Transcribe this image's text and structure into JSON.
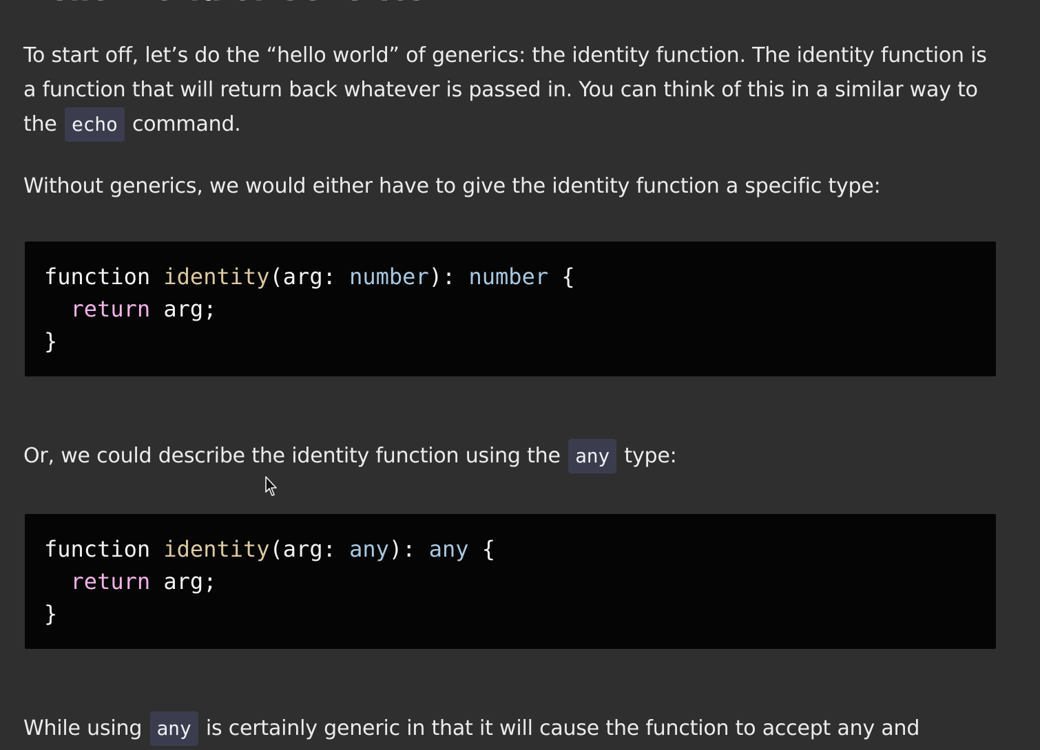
{
  "heading": "Hello World of Generics",
  "paragraph1": {
    "before_code": "To start off, let’s do the “hello world” of generics: the identity function. The identity function is a function that will return back whatever is passed in. You can think of this in a similar way to the ",
    "code": "echo",
    "after_code": " command."
  },
  "paragraph2": "Without generics, we would either have to give the identity function a specific type:",
  "code_block_1": {
    "lines": [
      {
        "keyword": "function",
        "space1": " ",
        "name": "identity",
        "open": "(arg: ",
        "param_type": "number",
        "close": "): ",
        "return_type": "number",
        "brace": " {"
      },
      {
        "indent": "  ",
        "ret": "return",
        "rest": " arg;"
      },
      {
        "text": "}"
      }
    ]
  },
  "paragraph3": {
    "before_code": "Or, we could describe the identity function using the ",
    "code": "any",
    "after_code": " type:"
  },
  "code_block_2": {
    "lines": [
      {
        "keyword": "function",
        "space1": " ",
        "name": "identity",
        "open": "(arg: ",
        "param_type": "any",
        "close": "): ",
        "return_type": "any",
        "brace": " {"
      },
      {
        "indent": "  ",
        "ret": "return",
        "rest": " arg;"
      },
      {
        "text": "}"
      }
    ]
  },
  "paragraph4": {
    "before_code": "While using ",
    "code": "any",
    "after_code": " is certainly generic in that it will cause the function to accept any and"
  },
  "icons": {
    "cursor": "mouse-pointer-icon"
  },
  "colors": {
    "background": "#2f2f2f",
    "code_background": "#050505",
    "inline_code_background": "#3b3d4f",
    "function_name": "#dcc9a3",
    "type": "#a9c7e0",
    "return_keyword": "#f2b3e8"
  }
}
